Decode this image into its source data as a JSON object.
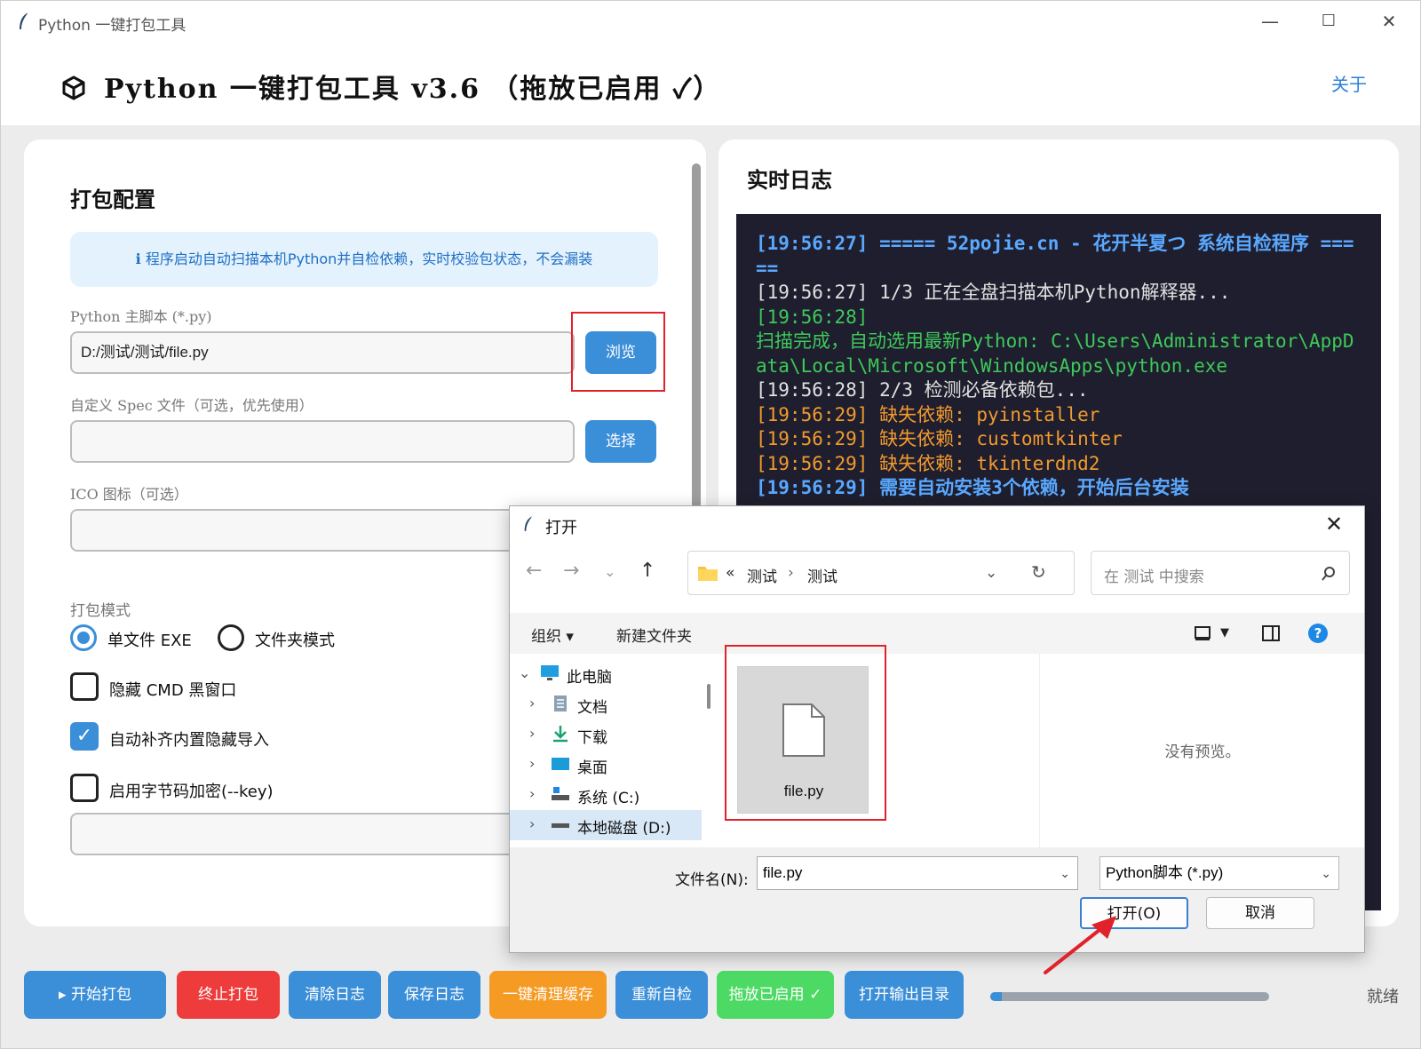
{
  "window": {
    "title": "Python 一键打包工具",
    "controls": {
      "minimize": "—",
      "maximize": "☐",
      "close": "✕"
    }
  },
  "header": {
    "title": "Python 一键打包工具 v3.6 （拖放已启用 ✓）",
    "about": "关于"
  },
  "config": {
    "title": "打包配置",
    "info": "ℹ 程序启动自动扫描本机Python并自检依赖，实时校验包状态，不会漏装",
    "main_script_label": "Python 主脚本 (*.py)",
    "main_script_value": "D:/测试/测试/file.py",
    "browse": "浏览",
    "spec_label": "自定义 Spec 文件（可选，优先使用）",
    "spec_value": "",
    "choose": "选择",
    "ico_label": "ICO 图标（可选）",
    "ico_value": "",
    "mode_label": "打包模式",
    "mode_single": "单文件 EXE",
    "mode_folder": "文件夹模式",
    "mode_selected": "single",
    "hide_cmd": "隐藏 CMD 黑窗口",
    "hide_cmd_checked": false,
    "auto_imports": "自动补齐内置隐藏导入",
    "auto_imports_checked": true,
    "encrypt": "启用字节码加密(--key)",
    "encrypt_checked": false,
    "key_value": ""
  },
  "log": {
    "title": "实时日志",
    "lines": [
      {
        "text": "[19:56:27] ===== 52pojie.cn - 花开半夏つ 系统自检程序 =====",
        "color": "blue"
      },
      {
        "text": "[19:56:27] 1/3 正在全盘扫描本机Python解释器...",
        "color": "white"
      },
      {
        "text": "[19:56:28]",
        "color": "green"
      },
      {
        "text": "扫描完成，自动选用最新Python: C:\\Users\\Administrator\\AppData\\Local\\Microsoft\\WindowsApps\\python.exe",
        "color": "green"
      },
      {
        "text": "[19:56:28] 2/3 检测必备依赖包...",
        "color": "white"
      },
      {
        "text": "[19:56:29] 缺失依赖: pyinstaller",
        "color": "orange"
      },
      {
        "text": "[19:56:29] 缺失依赖: customtkinter",
        "color": "orange"
      },
      {
        "text": "[19:56:29] 缺失依赖: tkinterdnd2",
        "color": "orange"
      },
      {
        "text": "[19:56:29] 需要自动安装3个依赖，开始后台安装",
        "color": "blue"
      }
    ]
  },
  "bottom": {
    "buttons": [
      {
        "label": "▸ 开始打包",
        "color": "#3b8ed8"
      },
      {
        "label": "终止打包",
        "color": "#ee3b3b"
      },
      {
        "label": "清除日志",
        "color": "#3b8ed8"
      },
      {
        "label": "保存日志",
        "color": "#3b8ed8"
      },
      {
        "label": "一键清理缓存",
        "color": "#f59a23"
      },
      {
        "label": "重新自检",
        "color": "#3b8ed8"
      },
      {
        "label": "拖放已启用 ✓",
        "color": "#4cd964"
      },
      {
        "label": "打开输出目录",
        "color": "#3b8ed8"
      }
    ],
    "progress": 0.04,
    "status": "就绪"
  },
  "dialog": {
    "title": "打开",
    "close": "✕",
    "path": [
      "测试",
      "测试"
    ],
    "path_prefix": "«",
    "search_placeholder": "在 测试 中搜索",
    "organize": "组织 ▾",
    "new_folder": "新建文件夹",
    "tree": [
      {
        "label": "此电脑",
        "expanded": true,
        "icon": "pc-icon"
      },
      {
        "label": "文档",
        "icon": "document-icon"
      },
      {
        "label": "下载",
        "icon": "download-icon"
      },
      {
        "label": "桌面",
        "icon": "desktop-icon"
      },
      {
        "label": "系统 (C:)",
        "icon": "drive-c-icon"
      },
      {
        "label": "本地磁盘 (D:)",
        "icon": "drive-d-icon",
        "selected": true
      }
    ],
    "file_name": "file.py",
    "no_preview": "没有预览。",
    "filename_label": "文件名(N):",
    "filename_value": "file.py",
    "filetype": "Python脚本 (*.py)",
    "open": "打开(O)",
    "cancel": "取消"
  },
  "colors": {
    "accent": "#3b8ed8",
    "highlight": "#e0222a",
    "log_bg": "#1e1e2e"
  }
}
